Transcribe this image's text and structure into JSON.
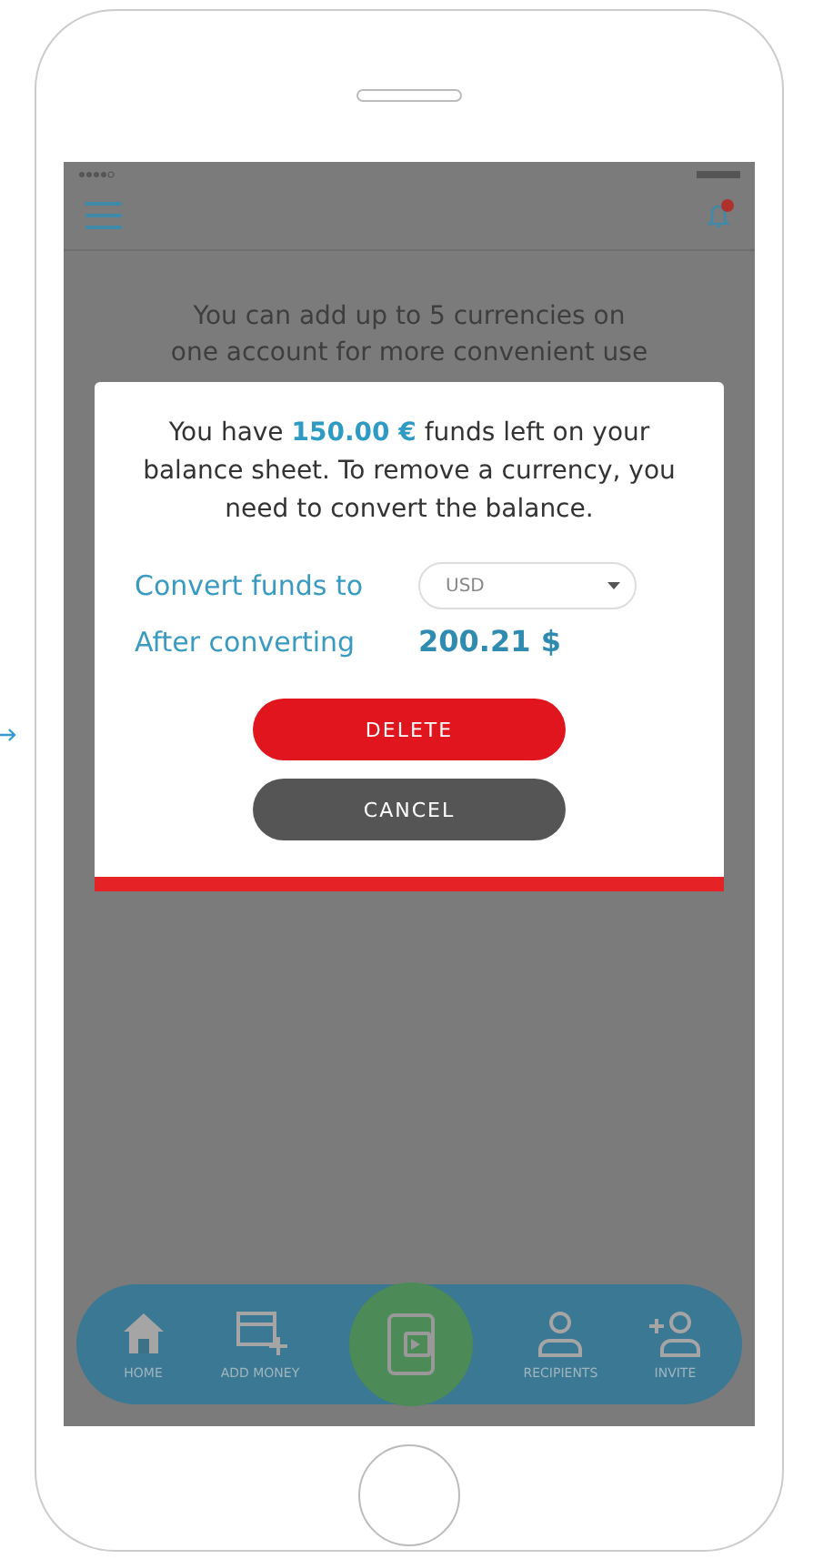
{
  "screen_text": [
    "You can add up to 5 currencies on",
    "one account  for more convenient use"
  ],
  "header": {
    "notification_badge": true
  },
  "dialog": {
    "message": "You have **150.00 €** funds left on your balance sheet. To remove a currency, you need to convert the balance.",
    "convert_label": "Convert funds to",
    "currency": "USD",
    "after_label": "After converting",
    "after_value": "200.21 $",
    "buttons": [
      {
        "label": "DELETE",
        "kind": "primary"
      },
      {
        "label": "CANCEL",
        "kind": "secondary"
      }
    ]
  },
  "nav": [
    {
      "label": "HOME",
      "kind": "home"
    },
    {
      "label": "ADD MONEY",
      "kind": "card"
    },
    {
      "kind": "wallet"
    },
    {
      "label": "RECIPIENTS",
      "kind": "person"
    },
    {
      "label": "INVITE",
      "kind": "invite"
    }
  ]
}
